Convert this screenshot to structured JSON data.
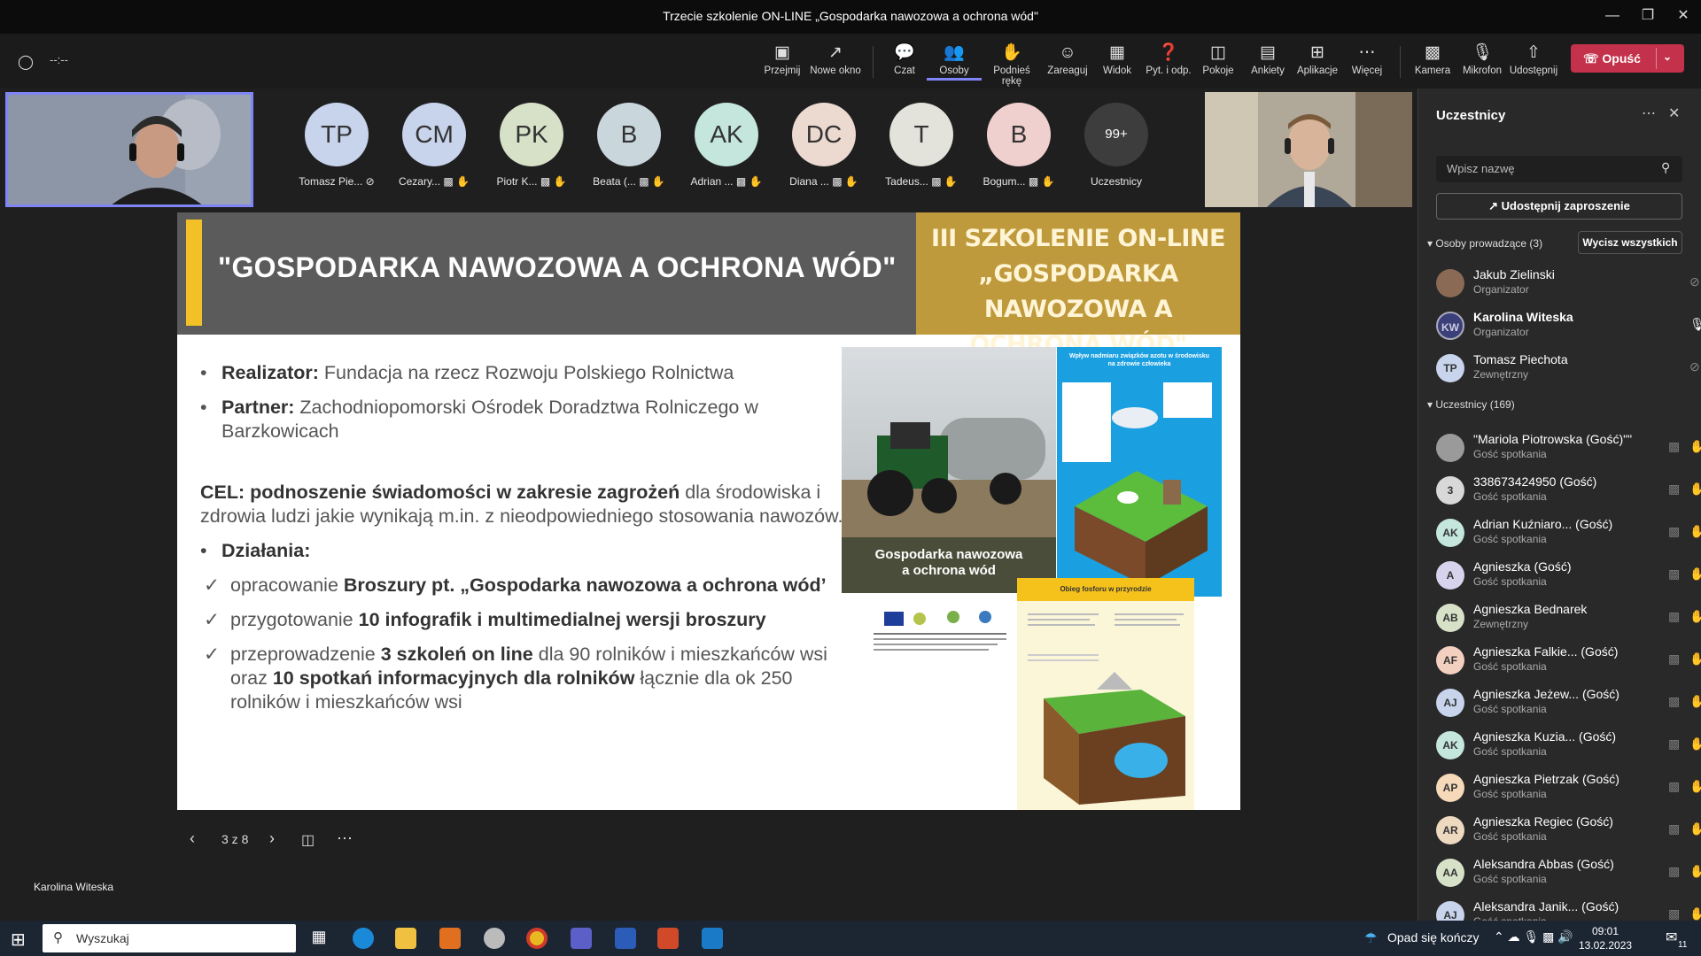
{
  "window": {
    "title": "Trzecie szkolenie ON-LINE „Gospodarka nawozowa a ochrona wód\""
  },
  "toolbar": {
    "timer": "--:--",
    "items": [
      {
        "label": "Przejmij",
        "icon": "take-control-icon"
      },
      {
        "label": "Nowe okno",
        "icon": "pop-out-icon"
      },
      {
        "label": "Czat",
        "icon": "chat-icon"
      },
      {
        "label": "Osoby",
        "icon": "people-icon"
      },
      {
        "label": "Podnieś rękę",
        "icon": "raise-hand-icon"
      },
      {
        "label": "Zareaguj",
        "icon": "react-icon"
      },
      {
        "label": "Widok",
        "icon": "view-icon"
      },
      {
        "label": "Pyt. i odp.",
        "icon": "qa-icon"
      },
      {
        "label": "Pokoje",
        "icon": "rooms-icon"
      },
      {
        "label": "Ankiety",
        "icon": "polls-icon"
      },
      {
        "label": "Aplikacje",
        "icon": "apps-icon"
      },
      {
        "label": "Więcej",
        "icon": "more-icon"
      },
      {
        "label": "Kamera",
        "icon": "camera-icon"
      },
      {
        "label": "Mikrofon",
        "icon": "mic-off-icon"
      },
      {
        "label": "Udostępnij",
        "icon": "share-icon"
      }
    ],
    "leave_label": "Opuść"
  },
  "strip": {
    "avatars": [
      {
        "initials": "TP",
        "name": "Tomasz Pie...",
        "color": "#c7d4ec"
      },
      {
        "initials": "CM",
        "name": "Cezary...",
        "color": "#c8d3ec"
      },
      {
        "initials": "PK",
        "name": "Piotr K...",
        "color": "#d7e1c8"
      },
      {
        "initials": "B",
        "name": "Beata (...",
        "color": "#c9d7dd"
      },
      {
        "initials": "AK",
        "name": "Adrian ...",
        "color": "#c4e6dc"
      },
      {
        "initials": "DC",
        "name": "Diana ...",
        "color": "#ecd9d0"
      },
      {
        "initials": "T",
        "name": "Tadeus...",
        "color": "#e3e3db"
      },
      {
        "initials": "B",
        "name": "Bogum...",
        "color": "#f0d0cf"
      }
    ],
    "overflow": {
      "count": "99+",
      "label": "Uczestnicy"
    }
  },
  "slide": {
    "header": "\"GOSPODARKA NAWOZOWA A OCHRONA WÓD\"",
    "banner": [
      "III SZKOLENIE ON-LINE",
      "„GOSPODARKA NAWOZOWA A",
      "OCHRONA WÓD\""
    ],
    "realizator_label": "Realizator:",
    "realizator_value": " Fundacja na rzecz Rozwoju Polskiego Rolnictwa",
    "partner_label": "Partner:",
    "partner_value": " Zachodniopomorski Ośrodek Doradztwa Rolniczego w Barzkowicach",
    "cel_bold": "CEL: podnoszenie świadomości w zakresie zagrożeń",
    "cel_rest": " dla środowiska i zdrowia ludzi  jakie wynikają  m.in. z nieodpowiedniego stosowania nawozów.",
    "dzialania": "Działania:",
    "actions": [
      {
        "a": "opracowanie ",
        "b": "Broszury  pt. „Gospodarka nawozowa a ochrona wód’",
        "c": ""
      },
      {
        "a": " przygotowanie ",
        "b": "10 infografik i  multimedialnej wersji broszury",
        "c": ""
      },
      {
        "a": "przeprowadzenie ",
        "b": "3 szkoleń on line",
        "c": " dla 90 rolników i mieszkańców wsi oraz  ",
        "d": "10 spotkań informacyjnych dla rolników",
        "e": " łącznie dla ok 250 rolników i mieszkańców wsi"
      }
    ],
    "cover_caption": [
      "Gospodarka nawozowa",
      "a ochrona wód"
    ],
    "infographic1_title": "Wpływ nadmiaru związków azotu w środowisku na zdrowie człowieka",
    "infographic2_title": "Obieg fosforu w przyrodzie"
  },
  "slide_nav": {
    "page": "3 z 8"
  },
  "presenter_name": "Karolina Witeska",
  "panel": {
    "title": "Uczestnicy",
    "search_placeholder": "Wpisz nazwę",
    "share_invite": "Udostępnij zaproszenie",
    "presenters_header": "Osoby prowadzące (3)",
    "mute_all": "Wycisz wszystkich",
    "presenters": [
      {
        "initials": "",
        "name": "Jakub Zielinski",
        "sub": "Organizator",
        "color": "#8a6a55"
      },
      {
        "initials": "KW",
        "name": "Karolina Witeska",
        "sub": "Organizator",
        "color": "#3b3f7a"
      },
      {
        "initials": "TP",
        "name": "Tomasz Piechota",
        "sub": "Zewnętrzny",
        "color": "#c7d4ec"
      }
    ],
    "attendees_header": "Uczestnicy (169)",
    "attendees": [
      {
        "initials": "",
        "name": "\"Mariola Piotrowska (Gość)\"\"",
        "sub": "Gość spotkania",
        "color": "#9a9a9a"
      },
      {
        "initials": "3",
        "name": "338673424950 (Gość)",
        "sub": "Gość spotkania",
        "color": "#d8d8d8"
      },
      {
        "initials": "AK",
        "name": "Adrian Kuźniaro...  (Gość)",
        "sub": "Gość spotkania",
        "color": "#c4e6dc"
      },
      {
        "initials": "A",
        "name": "Agnieszka (Gość)",
        "sub": "Gość spotkania",
        "color": "#d8d3ec"
      },
      {
        "initials": "AB",
        "name": "Agnieszka Bednarek",
        "sub": "Zewnętrzny",
        "color": "#d7e1c8"
      },
      {
        "initials": "AF",
        "name": "Agnieszka Falkie...  (Gość)",
        "sub": "Gość spotkania",
        "color": "#f3cfc0"
      },
      {
        "initials": "AJ",
        "name": "Agnieszka Jeżew...  (Gość)",
        "sub": "Gość spotkania",
        "color": "#c7d4ec"
      },
      {
        "initials": "AK",
        "name": "Agnieszka Kuzia...  (Gość)",
        "sub": "Gość spotkania",
        "color": "#c4e6dc"
      },
      {
        "initials": "AP",
        "name": "Agnieszka Pietrzak (Gość)",
        "sub": "Gość spotkania",
        "color": "#f5d9b8"
      },
      {
        "initials": "AR",
        "name": "Agnieszka Regiec (Gość)",
        "sub": "Gość spotkania",
        "color": "#ecd9c0"
      },
      {
        "initials": "AA",
        "name": "Aleksandra Abbas (Gość)",
        "sub": "Gość spotkania",
        "color": "#d7e1c8"
      },
      {
        "initials": "AJ",
        "name": "Aleksandra Janik...  (Gość)",
        "sub": "Gość spotkania",
        "color": "#c7d4ec"
      }
    ]
  },
  "taskbar": {
    "search": "Wyszukaj",
    "weather": "Opad się kończy",
    "time": "09:01",
    "date": "13.02.2023",
    "notifications": "11"
  }
}
